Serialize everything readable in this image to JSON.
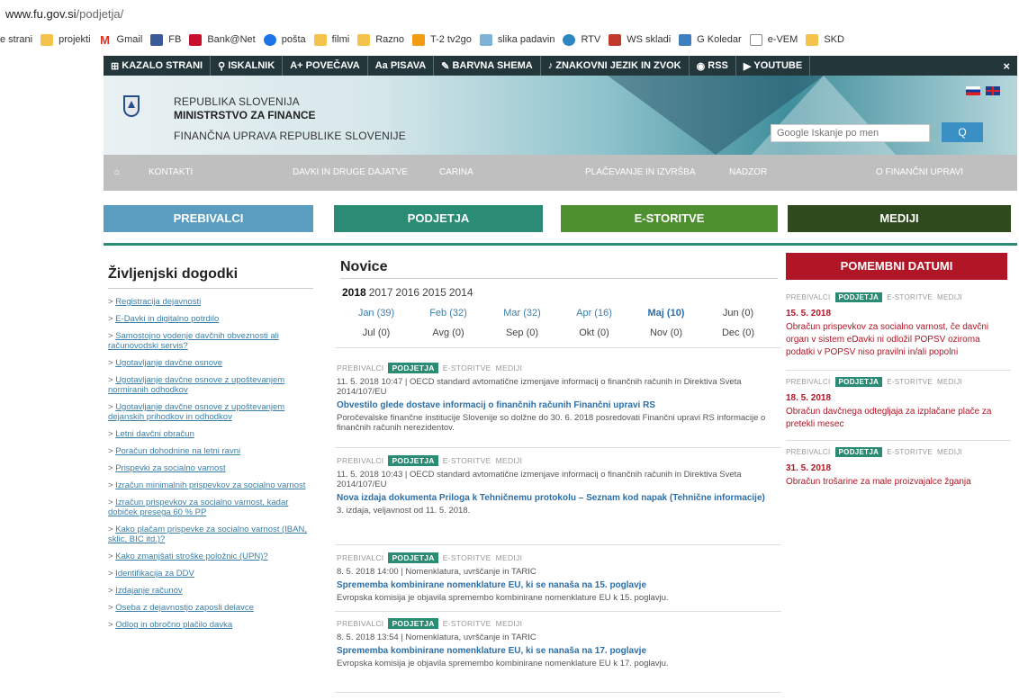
{
  "browser": {
    "url_host": "www.fu.gov.si",
    "url_path": "/podjetja/",
    "bookmarks": [
      {
        "label": "e strani",
        "icon": "none"
      },
      {
        "label": "projekti",
        "icon": "folder-icon"
      },
      {
        "label": "Gmail",
        "icon": "gmail-icon"
      },
      {
        "label": "FB",
        "icon": "facebook-icon"
      },
      {
        "label": "Bank@Net",
        "icon": "bank-icon"
      },
      {
        "label": "pošta",
        "icon": "mail-icon"
      },
      {
        "label": "filmi",
        "icon": "folder-icon"
      },
      {
        "label": "Razno",
        "icon": "folder-icon"
      },
      {
        "label": "T-2 tv2go",
        "icon": "tv-icon"
      },
      {
        "label": "slika padavin",
        "icon": "weather-icon"
      },
      {
        "label": "RTV",
        "icon": "rtv-icon"
      },
      {
        "label": "WS skladi",
        "icon": "ws-icon"
      },
      {
        "label": "G Koledar",
        "icon": "calendar-icon"
      },
      {
        "label": "e-VEM",
        "icon": "document-icon"
      },
      {
        "label": "SKD",
        "icon": "folder-icon"
      }
    ]
  },
  "toolbar": {
    "items": [
      "KAZALO STRANI",
      "ISKALNIK",
      "A+ POVEČAVA",
      "Aa PISAVA",
      "BARVNA SHEMA",
      "ZNAKOVNI JEZIK IN ZVOK",
      "RSS",
      "YOUTUBE"
    ],
    "close": "×"
  },
  "header": {
    "org_line1": "REPUBLIKA SLOVENIJA",
    "org_line2": "MINISTRSTVO ZA FINANCE",
    "org_line3": "FINANČNA UPRAVA REPUBLIKE SLOVENIJE",
    "search_placeholder": "Google Iskanje po men",
    "search_prefix": "Google",
    "search_button": "Q"
  },
  "nav": {
    "home": "⌂",
    "items": [
      "KONTAKTI",
      "DAVKI IN DRUGE DAJATVE",
      "CARINA",
      "PLAČEVANJE IN IZVRŠBA",
      "NADZOR",
      "O FINANČNI UPRAVI"
    ]
  },
  "audience_tabs": [
    {
      "label": "PREBIVALCI",
      "color": "#5b9dc0"
    },
    {
      "label": "PODJETJA",
      "color": "#2b8c76"
    },
    {
      "label": "E-STORITVE",
      "color": "#4e8f30"
    },
    {
      "label": "MEDIJI",
      "color": "#2f4a1c"
    }
  ],
  "life_events": {
    "title": "Življenjski dogodki",
    "items": [
      "Registracija dejavnosti",
      "E-Davki in digitalno potrdilo",
      "Samostojno vodenje davčnih obveznosti ali računovodski servis?",
      "Ugotavljanje davčne osnove",
      "Ugotavljanje davčne osnove z upoštevanjem normiranih odhodkov",
      "Ugotavljanje davčne osnove z upoštevanjem dejanskih prihodkov in odhodkov",
      "Letni davčni obračun",
      "Poračun dohodnine na letni ravni",
      "Prispevki za socialno varnost",
      "Izračun minimalnih prispevkov za socialno varnost",
      "Izračun prispevkov za socialno varnost, kadar dobiček presega 60 % PP",
      "Kako plačam prispevke za socialno varnost (IBAN, sklic, BIC itd.)?",
      "Kako zmanjšati stroške položnic (UPN)?",
      "Identifikacija za DDV",
      "Izdajanje računov",
      "Oseba z dejavnostjo zaposli delavce",
      "Odlog in obročno plačilo davka"
    ]
  },
  "news": {
    "title": "Novice",
    "years": [
      "2018",
      "2017",
      "2016",
      "2015",
      "2014"
    ],
    "current_year": "2018",
    "months": [
      {
        "label": "Jan (39)",
        "state": "link"
      },
      {
        "label": "Feb (32)",
        "state": "link"
      },
      {
        "label": "Mar (32)",
        "state": "link"
      },
      {
        "label": "Apr (16)",
        "state": "link"
      },
      {
        "label": "Maj (10)",
        "state": "active"
      },
      {
        "label": "Jun (0)",
        "state": "plain"
      },
      {
        "label": "Jul (0)",
        "state": "plain"
      },
      {
        "label": "Avg (0)",
        "state": "plain"
      },
      {
        "label": "Sep (0)",
        "state": "plain"
      },
      {
        "label": "Okt (0)",
        "state": "plain"
      },
      {
        "label": "Nov (0)",
        "state": "plain"
      },
      {
        "label": "Dec (0)",
        "state": "plain"
      }
    ],
    "tags": [
      "PREBIVALCI",
      "PODJETJA",
      "E-STORITVE",
      "MEDIJI"
    ],
    "active_tag": "PODJETJA",
    "items": [
      {
        "meta": "11. 5. 2018 10:47 | OECD standard avtomatične izmenjave informacij o finančnih računih in Direktiva Sveta 2014/107/EU",
        "headline": "Obvestilo glede dostave informacij o finančnih računih Finančni upravi RS",
        "desc": "Poročevalske finančne institucije Slovenije so dolžne do 30. 6. 2018 posredovati Finančni upravi RS informacije o finančnih računih nerezidentov."
      },
      {
        "meta": "11. 5. 2018 10:43 | OECD standard avtomatične izmenjave informacij o finančnih računih in Direktiva Sveta 2014/107/EU",
        "headline": "Nova izdaja dokumenta Priloga k Tehničnemu protokolu – Seznam kod napak (Tehnične informacije)",
        "desc": "3. izdaja, veljavnost od 11. 5. 2018."
      },
      {
        "meta": "8. 5. 2018 14:00 | Nomenklatura, uvrščanje in TARIC",
        "headline": "Sprememba kombinirane nomenklature EU, ki se nanaša na 15. poglavje",
        "desc": "Evropska komisija je objavila spremembo kombinirane nomenklature EU k 15. poglavju."
      },
      {
        "meta": "8. 5. 2018 13:54 | Nomenklatura, uvrščanje in TARIC",
        "headline": "Sprememba kombinirane nomenklature EU, ki se nanaša na 17. poglavje",
        "desc": "Evropska komisija je objavila spremembo kombinirane nomenklature EU k 17. poglavju."
      }
    ]
  },
  "important_dates": {
    "title": "POMEMBNI DATUMI",
    "items": [
      {
        "date": "15. 5. 2018",
        "text": "Obračun prispevkov za socialno varnost, če davčni organ v sistem eDavki ni odložil POPSV oziroma podatki v POPSV niso pravilni in/ali popolni"
      },
      {
        "date": "18. 5. 2018",
        "text": "Obračun davčnega odtegljaja za izplačane plače za pretekli mesec"
      },
      {
        "date": "31. 5. 2018",
        "text": "Obračun trošarine za male proizvajalce žganja"
      }
    ]
  },
  "colors": {
    "accent_teal": "#2b8c76",
    "toolbar_dark": "#23373b",
    "important_red": "#b11626",
    "link_blue": "#3a7fa8"
  }
}
